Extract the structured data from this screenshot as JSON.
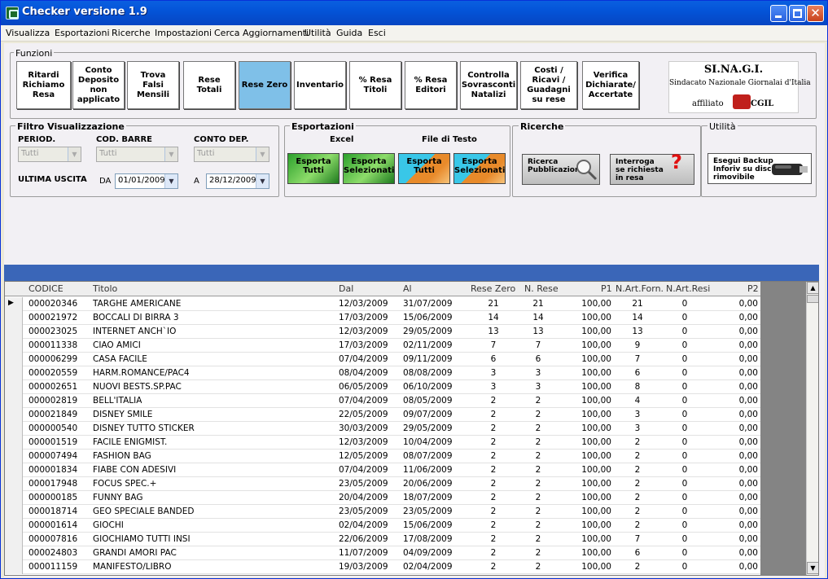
{
  "window": {
    "title": "Checker versione 1.9"
  },
  "menu": [
    "Visualizza",
    "Esportazioni",
    "Ricerche",
    "Impostazioni",
    "Cerca Aggiornamenti",
    "Utilità",
    "Guida",
    "Esci"
  ],
  "funzioni": {
    "title": "Funzioni",
    "buttons": [
      "Ritardi Richiamo Resa",
      "Conto Deposito non applicato",
      "Trova Falsi Mensili",
      "Rese Totali",
      "Rese Zero",
      "Inventario",
      "% Resa Titoli",
      "% Resa Editori",
      "Controlla Sovrasconti Natalizi",
      "Costi / Ricavi / Guadagni su rese",
      "Verifica Dichiarate/ Accertate"
    ],
    "active": "Rese Zero"
  },
  "logo": {
    "name": "SI.NA.G.I.",
    "subtitle": "Sindacato Nazionale Giornalai d'Italia",
    "affiliato": "affiliato",
    "badge": "SLC",
    "cgil": "CGIL"
  },
  "filtro": {
    "title": "Filtro Visualizzazione",
    "period_label": "PERIOD.",
    "period_value": "Tutti",
    "barre_label": "COD. BARRE",
    "barre_value": "Tutti",
    "conto_label": "CONTO DEP.",
    "conto_value": "Tutti",
    "ultima_label": "ULTIMA USCITA",
    "da_label": "DA",
    "da_value": "01/01/2009",
    "a_label": "A",
    "a_value": "28/12/2009"
  },
  "esportazioni": {
    "title": "Esportazioni",
    "excel_label": "Excel",
    "testo_label": "File di Testo",
    "buttons": [
      {
        "l1": "Esporta",
        "l2": "Tutti"
      },
      {
        "l1": "Esporta",
        "l2": "Selezionati"
      },
      {
        "l1": "Esporta",
        "l2": "Tutti"
      },
      {
        "l1": "Esporta",
        "l2": "Selezionati"
      }
    ]
  },
  "ricerche": {
    "title": "Ricerche",
    "ricerca_l1": "Ricerca",
    "ricerca_l2": "Pubblicazione",
    "interroga_l1": "Interroga",
    "interroga_l2": "se richiesta",
    "interroga_l3": "in resa",
    "question": "?"
  },
  "utilita": {
    "title": "Utilità",
    "backup_l1": "Esegui Backup",
    "backup_l2": "Inforiv su disco",
    "backup_l3": "rimovibile"
  },
  "table": {
    "columns": [
      "CODICE",
      "Titolo",
      "Dal",
      "Al",
      "Rese Zero",
      "N. Rese",
      "P1",
      "N.Art.Forn.",
      "N.Art.Resi",
      "P2"
    ],
    "rows": [
      [
        "000020346",
        "TARGHE AMERICANE",
        "12/03/2009",
        "31/07/2009",
        "21",
        "21",
        "100,00",
        "21",
        "0",
        "0,00"
      ],
      [
        "000021972",
        "BOCCALI DI BIRRA 3",
        "17/03/2009",
        "15/06/2009",
        "14",
        "14",
        "100,00",
        "14",
        "0",
        "0,00"
      ],
      [
        "000023025",
        "INTERNET ANCH`IO",
        "12/03/2009",
        "29/05/2009",
        "13",
        "13",
        "100,00",
        "13",
        "0",
        "0,00"
      ],
      [
        "000011338",
        "CIAO AMICI",
        "17/03/2009",
        "02/11/2009",
        "7",
        "7",
        "100,00",
        "9",
        "0",
        "0,00"
      ],
      [
        "000006299",
        "CASA FACILE",
        "07/04/2009",
        "09/11/2009",
        "6",
        "6",
        "100,00",
        "7",
        "0",
        "0,00"
      ],
      [
        "000020559",
        "HARM.ROMANCE/PAC4",
        "08/04/2009",
        "08/08/2009",
        "3",
        "3",
        "100,00",
        "6",
        "0",
        "0,00"
      ],
      [
        "000002651",
        "NUOVI BESTS.SP.PAC",
        "06/05/2009",
        "06/10/2009",
        "3",
        "3",
        "100,00",
        "8",
        "0",
        "0,00"
      ],
      [
        "000002819",
        "BELL'ITALIA",
        "07/04/2009",
        "08/05/2009",
        "2",
        "2",
        "100,00",
        "4",
        "0",
        "0,00"
      ],
      [
        "000021849",
        "DISNEY SMILE",
        "22/05/2009",
        "09/07/2009",
        "2",
        "2",
        "100,00",
        "3",
        "0",
        "0,00"
      ],
      [
        "000000540",
        "DISNEY TUTTO STICKER",
        "30/03/2009",
        "29/05/2009",
        "2",
        "2",
        "100,00",
        "3",
        "0",
        "0,00"
      ],
      [
        "000001519",
        "FACILE ENIGMIST.",
        "12/03/2009",
        "10/04/2009",
        "2",
        "2",
        "100,00",
        "2",
        "0",
        "0,00"
      ],
      [
        "000007494",
        "FASHION BAG",
        "12/05/2009",
        "08/07/2009",
        "2",
        "2",
        "100,00",
        "2",
        "0",
        "0,00"
      ],
      [
        "000001834",
        "FIABE CON ADESIVI",
        "07/04/2009",
        "11/06/2009",
        "2",
        "2",
        "100,00",
        "2",
        "0",
        "0,00"
      ],
      [
        "000017948",
        "FOCUS SPEC.+",
        "23/05/2009",
        "20/06/2009",
        "2",
        "2",
        "100,00",
        "2",
        "0",
        "0,00"
      ],
      [
        "000000185",
        "FUNNY BAG",
        "20/04/2009",
        "18/07/2009",
        "2",
        "2",
        "100,00",
        "2",
        "0",
        "0,00"
      ],
      [
        "000018714",
        "GEO SPECIALE BANDED",
        "23/05/2009",
        "23/05/2009",
        "2",
        "2",
        "100,00",
        "2",
        "0",
        "0,00"
      ],
      [
        "000001614",
        "GIOCHI",
        "02/04/2009",
        "15/06/2009",
        "2",
        "2",
        "100,00",
        "2",
        "0",
        "0,00"
      ],
      [
        "000007816",
        "GIOCHIAMO TUTTI INSI",
        "22/06/2009",
        "17/08/2009",
        "2",
        "2",
        "100,00",
        "7",
        "0",
        "0,00"
      ],
      [
        "000024803",
        "GRANDI AMORI PAC",
        "11/07/2009",
        "04/09/2009",
        "2",
        "2",
        "100,00",
        "6",
        "0",
        "0,00"
      ],
      [
        "000011159",
        "MANIFESTO/LIBRO",
        "19/03/2009",
        "02/04/2009",
        "2",
        "2",
        "100,00",
        "2",
        "0",
        "0,00"
      ]
    ]
  },
  "row_indicator": "▶"
}
